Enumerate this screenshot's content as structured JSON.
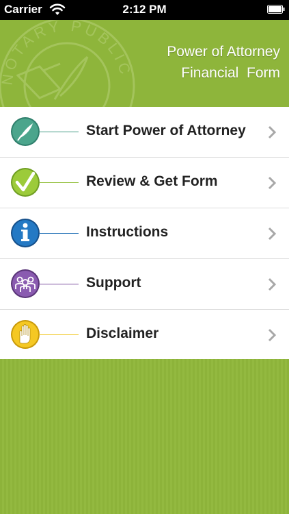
{
  "status_bar": {
    "carrier": "Carrier",
    "time": "2:12 PM",
    "wifi_icon": "wifi-icon",
    "battery_icon": "battery-icon"
  },
  "header": {
    "title_line1": "Power of Attorney",
    "title_line2": "Financial  Form",
    "seal_text": "NOTARY PUBLIC",
    "background_color": "#8eb53b"
  },
  "menu": {
    "items": [
      {
        "label": "Start Power of Attorney",
        "icon": "quill-icon",
        "color": "#3f9a82"
      },
      {
        "label": "Review & Get Form",
        "icon": "checkmark-icon",
        "color": "#8bbb2e"
      },
      {
        "label": "Instructions",
        "icon": "info-icon",
        "color": "#1f6fb6"
      },
      {
        "label": "Support",
        "icon": "people-icon",
        "color": "#7b4f9e"
      },
      {
        "label": "Disclaimer",
        "icon": "hand-icon",
        "color": "#f0c419"
      }
    ]
  },
  "colors": {
    "background": "#8db33a",
    "menu_background": "#ffffff",
    "chevron": "#a8a8a8"
  }
}
